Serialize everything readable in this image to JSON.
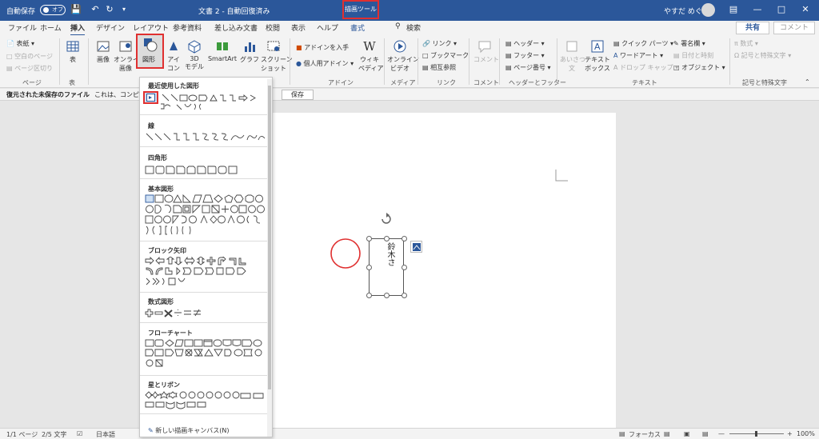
{
  "titlebar": {
    "autosave": "自動保存",
    "autosave_state": "オフ",
    "doc_title": "文書 2  -  自動回復済み",
    "context_tool": "描画ツール",
    "user_name": "やすだ めぐみ"
  },
  "tabs": [
    "ファイル",
    "ホーム",
    "挿入",
    "デザイン",
    "レイアウト",
    "参考資料",
    "差し込み文書",
    "校閲",
    "表示",
    "ヘルプ",
    "書式"
  ],
  "search_label": "検索",
  "share_label": "共有",
  "comment_label": "コメント",
  "ribbon": {
    "pages": {
      "cover": "表紙",
      "blank": "空白のページ",
      "break": "ページ区切り",
      "group": "ページ"
    },
    "table": {
      "label": "表",
      "group": "表"
    },
    "illust": {
      "picture": "画像",
      "online1": "オンライン",
      "online2": "画像",
      "shapes": "図形",
      "icon1": "アイ",
      "icon2": "コン",
      "model1": "3D",
      "model2": "モデル",
      "smartart": "SmartArt",
      "graph": "グラフ",
      "screenshot1": "スクリーン",
      "screenshot2": "ショット"
    },
    "addin": {
      "get": "アドインを入手",
      "personal": "個人用アドイン",
      "wiki1": "ウィキ",
      "wiki2": "ペディア",
      "group": "アドイン"
    },
    "media": {
      "video1": "オンライン",
      "video2": "ビデオ",
      "group": "メディア"
    },
    "links": {
      "link": "リンク",
      "bookmark": "ブックマーク",
      "cross": "相互参照",
      "group": "リンク"
    },
    "comments": {
      "comment": "コメント",
      "group": "コメント"
    },
    "hf": {
      "header": "ヘッダー",
      "footer": "フッター",
      "pagenum": "ページ番号",
      "group": "ヘッダーとフッター"
    },
    "text": {
      "greeting1": "あいさつ",
      "greeting2": "文",
      "textbox1": "テキスト",
      "textbox2": "ボックス",
      "quickparts": "クイック パーツ",
      "wordart": "ワードアート",
      "dropcap": "ドロップ キャップ",
      "signature": "署名欄",
      "datetime": "日付と時刻",
      "object": "オブジェクト",
      "group": "テキスト"
    },
    "symbols": {
      "equation": "数式",
      "symbol": "記号と特殊文字",
      "group": "記号と特殊文字"
    }
  },
  "infobar": {
    "title": "復元された未保存のファイル",
    "message": "これは、コンピューター...",
    "save": "保存"
  },
  "dropdown": {
    "sections": [
      "最近使用した図形",
      "線",
      "四角形",
      "基本図形",
      "ブロック矢印",
      "数式図形",
      "フローチャート",
      "星とリボン"
    ],
    "new_canvas": "新しい描画キャンバス(N)"
  },
  "document": {
    "textbox_text": "鈴木さ"
  },
  "status": {
    "page": "1/1 ページ",
    "words": "2/5 文字",
    "lang": "日本語",
    "focus": "フォーカス",
    "zoom": "100%"
  },
  "colors": {
    "accent": "#2b579a",
    "highlight": "#e03030"
  }
}
